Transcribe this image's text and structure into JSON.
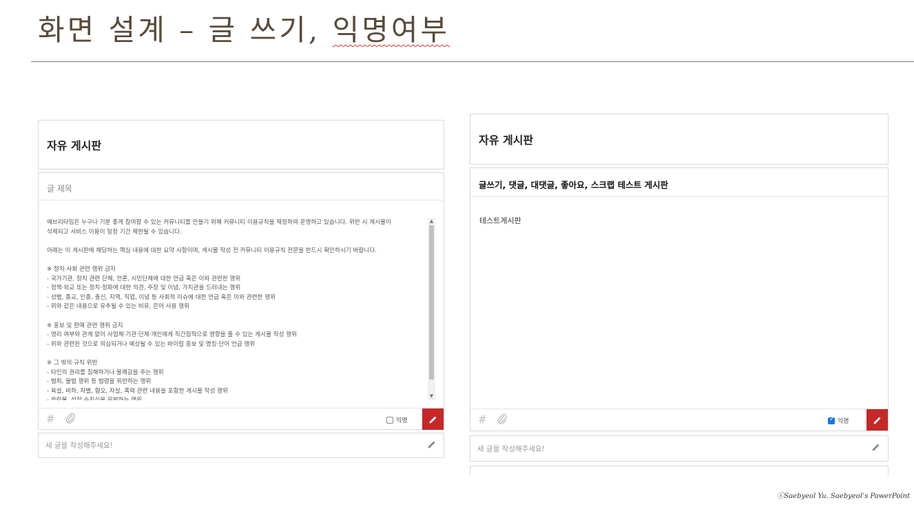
{
  "slide": {
    "title_part1": "화면 설계 – 글 쓰기, ",
    "title_part2": "익명여부",
    "copyright": "ⓒSaebyeol Yu. Saebyeol’s PowerPoint"
  },
  "left": {
    "board_name": "자유 게시판",
    "title_placeholder": "글 제목",
    "rules_lines": [
      "에브리타임은 누구나 기분 좋게 참여할 수 있는 커뮤니티를 만들기 위해 커뮤니티 이용규칙을 제정하여 운영하고 있습니다. 위반 시 게시물이",
      "삭제되고 서비스 이용이 일정 기간 제한될 수 있습니다.",
      "",
      "아래는 이 게시판에 해당하는 핵심 내용에 대한 요약 사항이며, 게시물 작성 전 커뮤니티 이용규칙 전문을 반드시 확인하시기 바랍니다.",
      "",
      "※ 정치·사회 관련 행위 금지",
      "- 국가기관, 정치 관련 단체, 언론, 시민단체에 대한 언급 혹은 이와 관련한 행위",
      "- 정책·외교 또는 정치·정파에 대한 의견, 주장 및 이념, 가치관을 드러내는 행위",
      "- 성별, 종교, 인종, 출신, 지역, 직업, 이념 등 사회적 이슈에 대한 언급 혹은 이와 관련한 행위",
      "- 위와 같은 내용으로 유추될 수 있는 비유, 은어 사용 행위",
      "",
      "※ 홍보 및 판매 관련 행위 금지",
      "- 영리 여부와 관계 없이 사업체·기관·단체·개인에게 직간접적으로 영향을 줄 수 있는 게시물 작성 행위",
      "- 위와 관련된 것으로 의심되거나 예상될 수 있는 바이럴 홍보 및 명칭·단어 언급 행위",
      "",
      "※ 그 밖의 규칙 위반",
      "- 타인의 권리를 침해하거나 불쾌감을 주는 행위",
      "- 범죄, 불법 행위 등 법령을 위반하는 행위",
      "- 욕설, 비하, 차별, 혐오, 자살, 폭력 관련 내용을 포함한 게시물 작성 행위",
      "- 음란물, 성적 수치심을 유발하는 행위"
    ],
    "anonymous_label": "익명",
    "new_post_placeholder": "새 글을 작성해주세요!"
  },
  "right": {
    "board_name": "자유 게시판",
    "post_title": "글쓰기, 댓글, 대댓글, 좋아요, 스크랩 테스트 게시판",
    "post_body": "테스트게시판",
    "anonymous_label": "익명",
    "new_post_placeholder": "새 글을 작성해주세요!"
  },
  "icons": {
    "hashtag": "#",
    "attach": "paperclip-icon",
    "write": "pencil-icon"
  },
  "colors": {
    "submit": "#c62828",
    "checkbox_checked": "#1a73e8",
    "title_text": "#5a4a3a"
  },
  "state": {
    "left_anonymous_checked": false,
    "right_anonymous_checked": true
  }
}
